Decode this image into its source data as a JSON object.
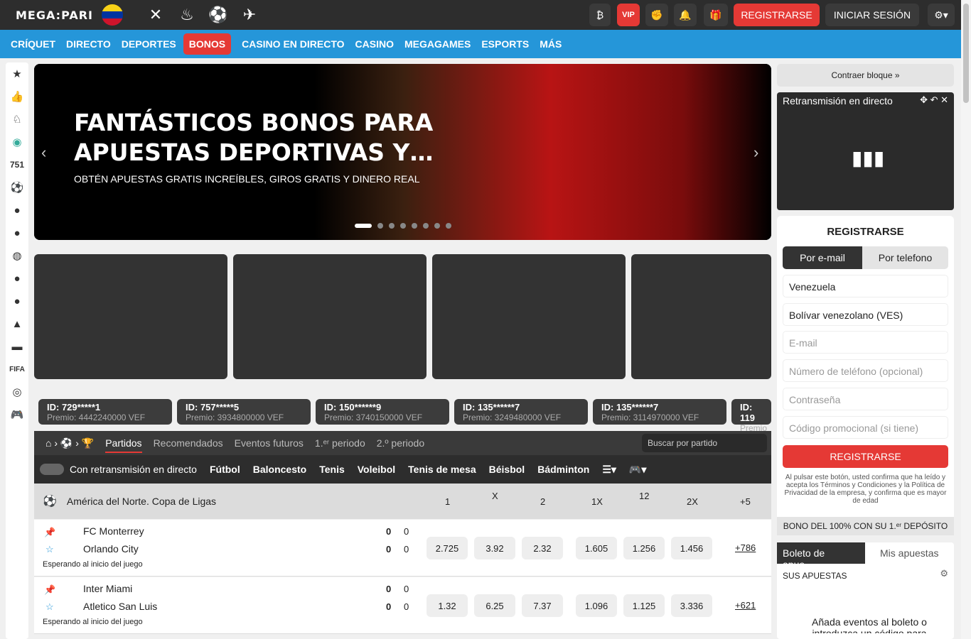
{
  "header": {
    "logo": "MEGA:PARI",
    "register": "REGISTRARSE",
    "login": "INICIAR SESIÓN",
    "vip": "VIP",
    "gift_count": "1",
    "brand_color": "#e53935"
  },
  "nav": {
    "items": [
      "CRÍQUET",
      "DIRECTO",
      "DEPORTES",
      "BONOS",
      "CASINO EN DIRECTO",
      "CASINO",
      "MEGAGAMES",
      "ESPORTS",
      "MÁS"
    ]
  },
  "sidebar": {
    "live_count": "751"
  },
  "banner": {
    "title": "FANTÁSTICOS BONOS PARA APUESTAS DEPORTIVAS Y…",
    "subtitle": "OBTÉN APUESTAS GRATIS INCREÍBLES, GIROS GRATIS Y DINERO REAL"
  },
  "ticker": [
    {
      "id": "ID: 729*****1",
      "prize": "Premio: 4442240000 VEF"
    },
    {
      "id": "ID: 757*****5",
      "prize": "Premio: 3934800000 VEF"
    },
    {
      "id": "ID: 150******9",
      "prize": "Premio: 3740150000 VEF"
    },
    {
      "id": "ID: 135******7",
      "prize": "Premio: 3249480000 VEF"
    },
    {
      "id": "ID: 135******7",
      "prize": "Premio: 3114970000 VEF"
    },
    {
      "id": "ID: 119",
      "prize": "Premio"
    }
  ],
  "tabs": [
    "Partidos",
    "Recomendados",
    "Eventos futuros",
    "1.ᵉʳ periodo",
    "2.º periodo"
  ],
  "search_placeholder": "Buscar por partido",
  "live_toggle": "Con retransmisión en directo",
  "sports": [
    "Fútbol",
    "Baloncesto",
    "Tenis",
    "Voleibol",
    "Tenis de mesa",
    "Béisbol",
    "Bádminton"
  ],
  "league": {
    "name": "América del Norte. Copa de Ligas",
    "cols": [
      "1",
      "X",
      "2",
      "1X",
      "12",
      "2X",
      "+5"
    ]
  },
  "matches": [
    {
      "t1": "FC Monterrey",
      "t2": "Orlando City",
      "s1": "0",
      "s2": "0",
      "p1": "0",
      "p2": "0",
      "status": "Esperando al inicio del juego",
      "odds": [
        "2.725",
        "3.92",
        "2.32",
        "1.605",
        "1.256",
        "1.456"
      ],
      "more": "+786"
    },
    {
      "t1": "Inter Miami",
      "t2": "Atletico San Luis",
      "s1": "0",
      "s2": "0",
      "p1": "0",
      "p2": "0",
      "status": "Esperando al inicio del juego",
      "odds": [
        "1.32",
        "6.25",
        "7.37",
        "1.096",
        "1.125",
        "3.336"
      ],
      "more": "+621"
    }
  ],
  "right": {
    "collapse": "Contraer bloque »",
    "stream": "Retransmisión en directo",
    "reg_title": "REGISTRARSE",
    "by_email": "Por e-mail",
    "by_phone": "Por telefono",
    "country": "Venezuela",
    "currency": "Bolívar venezolano (VES)",
    "email": "E-mail",
    "phone": "Número de teléfono (opcional)",
    "password": "Contraseña",
    "promo": "Código promocional (si tiene)",
    "reg_btn": "REGISTRARSE",
    "terms": "Al pulsar este botón, usted confirma que ha leído y acepta los Términos y Condiciones y la Política de Privacidad de la empresa, y confirma que es mayor de edad",
    "bonus": "BONO DEL 100% CON SU 1.ᵉʳ DEPÓSITO",
    "betslip": "Boleto de apue…",
    "mybets": "Mis apuestas",
    "your_bets": "SUS APUESTAS",
    "add_events": "Añada eventos al boleto o introduzca un código para"
  }
}
